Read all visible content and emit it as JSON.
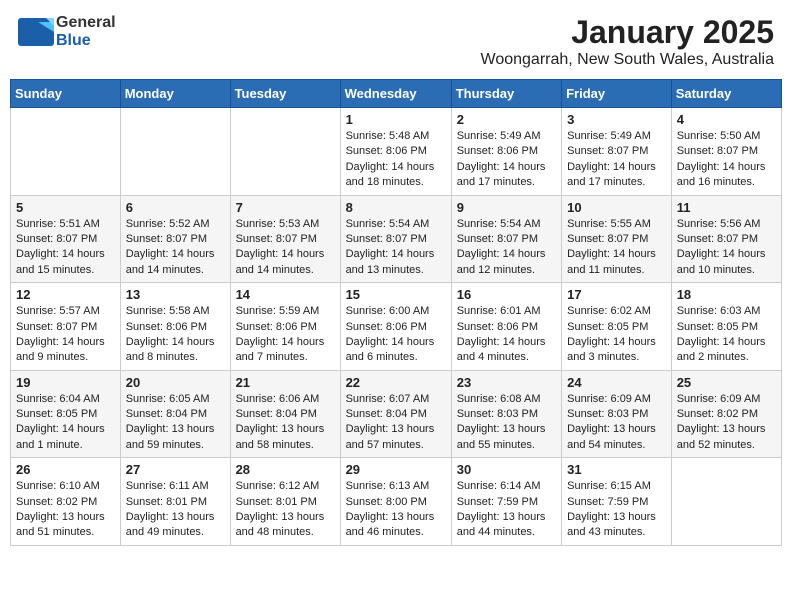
{
  "logo": {
    "general": "General",
    "blue": "Blue"
  },
  "title": "January 2025",
  "subtitle": "Woongarrah, New South Wales, Australia",
  "weekdays": [
    "Sunday",
    "Monday",
    "Tuesday",
    "Wednesday",
    "Thursday",
    "Friday",
    "Saturday"
  ],
  "weeks": [
    [
      {
        "day": "",
        "sunrise": "",
        "sunset": "",
        "daylight": ""
      },
      {
        "day": "",
        "sunrise": "",
        "sunset": "",
        "daylight": ""
      },
      {
        "day": "",
        "sunrise": "",
        "sunset": "",
        "daylight": ""
      },
      {
        "day": "1",
        "sunrise": "Sunrise: 5:48 AM",
        "sunset": "Sunset: 8:06 PM",
        "daylight": "Daylight: 14 hours and 18 minutes."
      },
      {
        "day": "2",
        "sunrise": "Sunrise: 5:49 AM",
        "sunset": "Sunset: 8:06 PM",
        "daylight": "Daylight: 14 hours and 17 minutes."
      },
      {
        "day": "3",
        "sunrise": "Sunrise: 5:49 AM",
        "sunset": "Sunset: 8:07 PM",
        "daylight": "Daylight: 14 hours and 17 minutes."
      },
      {
        "day": "4",
        "sunrise": "Sunrise: 5:50 AM",
        "sunset": "Sunset: 8:07 PM",
        "daylight": "Daylight: 14 hours and 16 minutes."
      }
    ],
    [
      {
        "day": "5",
        "sunrise": "Sunrise: 5:51 AM",
        "sunset": "Sunset: 8:07 PM",
        "daylight": "Daylight: 14 hours and 15 minutes."
      },
      {
        "day": "6",
        "sunrise": "Sunrise: 5:52 AM",
        "sunset": "Sunset: 8:07 PM",
        "daylight": "Daylight: 14 hours and 14 minutes."
      },
      {
        "day": "7",
        "sunrise": "Sunrise: 5:53 AM",
        "sunset": "Sunset: 8:07 PM",
        "daylight": "Daylight: 14 hours and 14 minutes."
      },
      {
        "day": "8",
        "sunrise": "Sunrise: 5:54 AM",
        "sunset": "Sunset: 8:07 PM",
        "daylight": "Daylight: 14 hours and 13 minutes."
      },
      {
        "day": "9",
        "sunrise": "Sunrise: 5:54 AM",
        "sunset": "Sunset: 8:07 PM",
        "daylight": "Daylight: 14 hours and 12 minutes."
      },
      {
        "day": "10",
        "sunrise": "Sunrise: 5:55 AM",
        "sunset": "Sunset: 8:07 PM",
        "daylight": "Daylight: 14 hours and 11 minutes."
      },
      {
        "day": "11",
        "sunrise": "Sunrise: 5:56 AM",
        "sunset": "Sunset: 8:07 PM",
        "daylight": "Daylight: 14 hours and 10 minutes."
      }
    ],
    [
      {
        "day": "12",
        "sunrise": "Sunrise: 5:57 AM",
        "sunset": "Sunset: 8:07 PM",
        "daylight": "Daylight: 14 hours and 9 minutes."
      },
      {
        "day": "13",
        "sunrise": "Sunrise: 5:58 AM",
        "sunset": "Sunset: 8:06 PM",
        "daylight": "Daylight: 14 hours and 8 minutes."
      },
      {
        "day": "14",
        "sunrise": "Sunrise: 5:59 AM",
        "sunset": "Sunset: 8:06 PM",
        "daylight": "Daylight: 14 hours and 7 minutes."
      },
      {
        "day": "15",
        "sunrise": "Sunrise: 6:00 AM",
        "sunset": "Sunset: 8:06 PM",
        "daylight": "Daylight: 14 hours and 6 minutes."
      },
      {
        "day": "16",
        "sunrise": "Sunrise: 6:01 AM",
        "sunset": "Sunset: 8:06 PM",
        "daylight": "Daylight: 14 hours and 4 minutes."
      },
      {
        "day": "17",
        "sunrise": "Sunrise: 6:02 AM",
        "sunset": "Sunset: 8:05 PM",
        "daylight": "Daylight: 14 hours and 3 minutes."
      },
      {
        "day": "18",
        "sunrise": "Sunrise: 6:03 AM",
        "sunset": "Sunset: 8:05 PM",
        "daylight": "Daylight: 14 hours and 2 minutes."
      }
    ],
    [
      {
        "day": "19",
        "sunrise": "Sunrise: 6:04 AM",
        "sunset": "Sunset: 8:05 PM",
        "daylight": "Daylight: 14 hours and 1 minute."
      },
      {
        "day": "20",
        "sunrise": "Sunrise: 6:05 AM",
        "sunset": "Sunset: 8:04 PM",
        "daylight": "Daylight: 13 hours and 59 minutes."
      },
      {
        "day": "21",
        "sunrise": "Sunrise: 6:06 AM",
        "sunset": "Sunset: 8:04 PM",
        "daylight": "Daylight: 13 hours and 58 minutes."
      },
      {
        "day": "22",
        "sunrise": "Sunrise: 6:07 AM",
        "sunset": "Sunset: 8:04 PM",
        "daylight": "Daylight: 13 hours and 57 minutes."
      },
      {
        "day": "23",
        "sunrise": "Sunrise: 6:08 AM",
        "sunset": "Sunset: 8:03 PM",
        "daylight": "Daylight: 13 hours and 55 minutes."
      },
      {
        "day": "24",
        "sunrise": "Sunrise: 6:09 AM",
        "sunset": "Sunset: 8:03 PM",
        "daylight": "Daylight: 13 hours and 54 minutes."
      },
      {
        "day": "25",
        "sunrise": "Sunrise: 6:09 AM",
        "sunset": "Sunset: 8:02 PM",
        "daylight": "Daylight: 13 hours and 52 minutes."
      }
    ],
    [
      {
        "day": "26",
        "sunrise": "Sunrise: 6:10 AM",
        "sunset": "Sunset: 8:02 PM",
        "daylight": "Daylight: 13 hours and 51 minutes."
      },
      {
        "day": "27",
        "sunrise": "Sunrise: 6:11 AM",
        "sunset": "Sunset: 8:01 PM",
        "daylight": "Daylight: 13 hours and 49 minutes."
      },
      {
        "day": "28",
        "sunrise": "Sunrise: 6:12 AM",
        "sunset": "Sunset: 8:01 PM",
        "daylight": "Daylight: 13 hours and 48 minutes."
      },
      {
        "day": "29",
        "sunrise": "Sunrise: 6:13 AM",
        "sunset": "Sunset: 8:00 PM",
        "daylight": "Daylight: 13 hours and 46 minutes."
      },
      {
        "day": "30",
        "sunrise": "Sunrise: 6:14 AM",
        "sunset": "Sunset: 7:59 PM",
        "daylight": "Daylight: 13 hours and 44 minutes."
      },
      {
        "day": "31",
        "sunrise": "Sunrise: 6:15 AM",
        "sunset": "Sunset: 7:59 PM",
        "daylight": "Daylight: 13 hours and 43 minutes."
      },
      {
        "day": "",
        "sunrise": "",
        "sunset": "",
        "daylight": ""
      }
    ]
  ]
}
